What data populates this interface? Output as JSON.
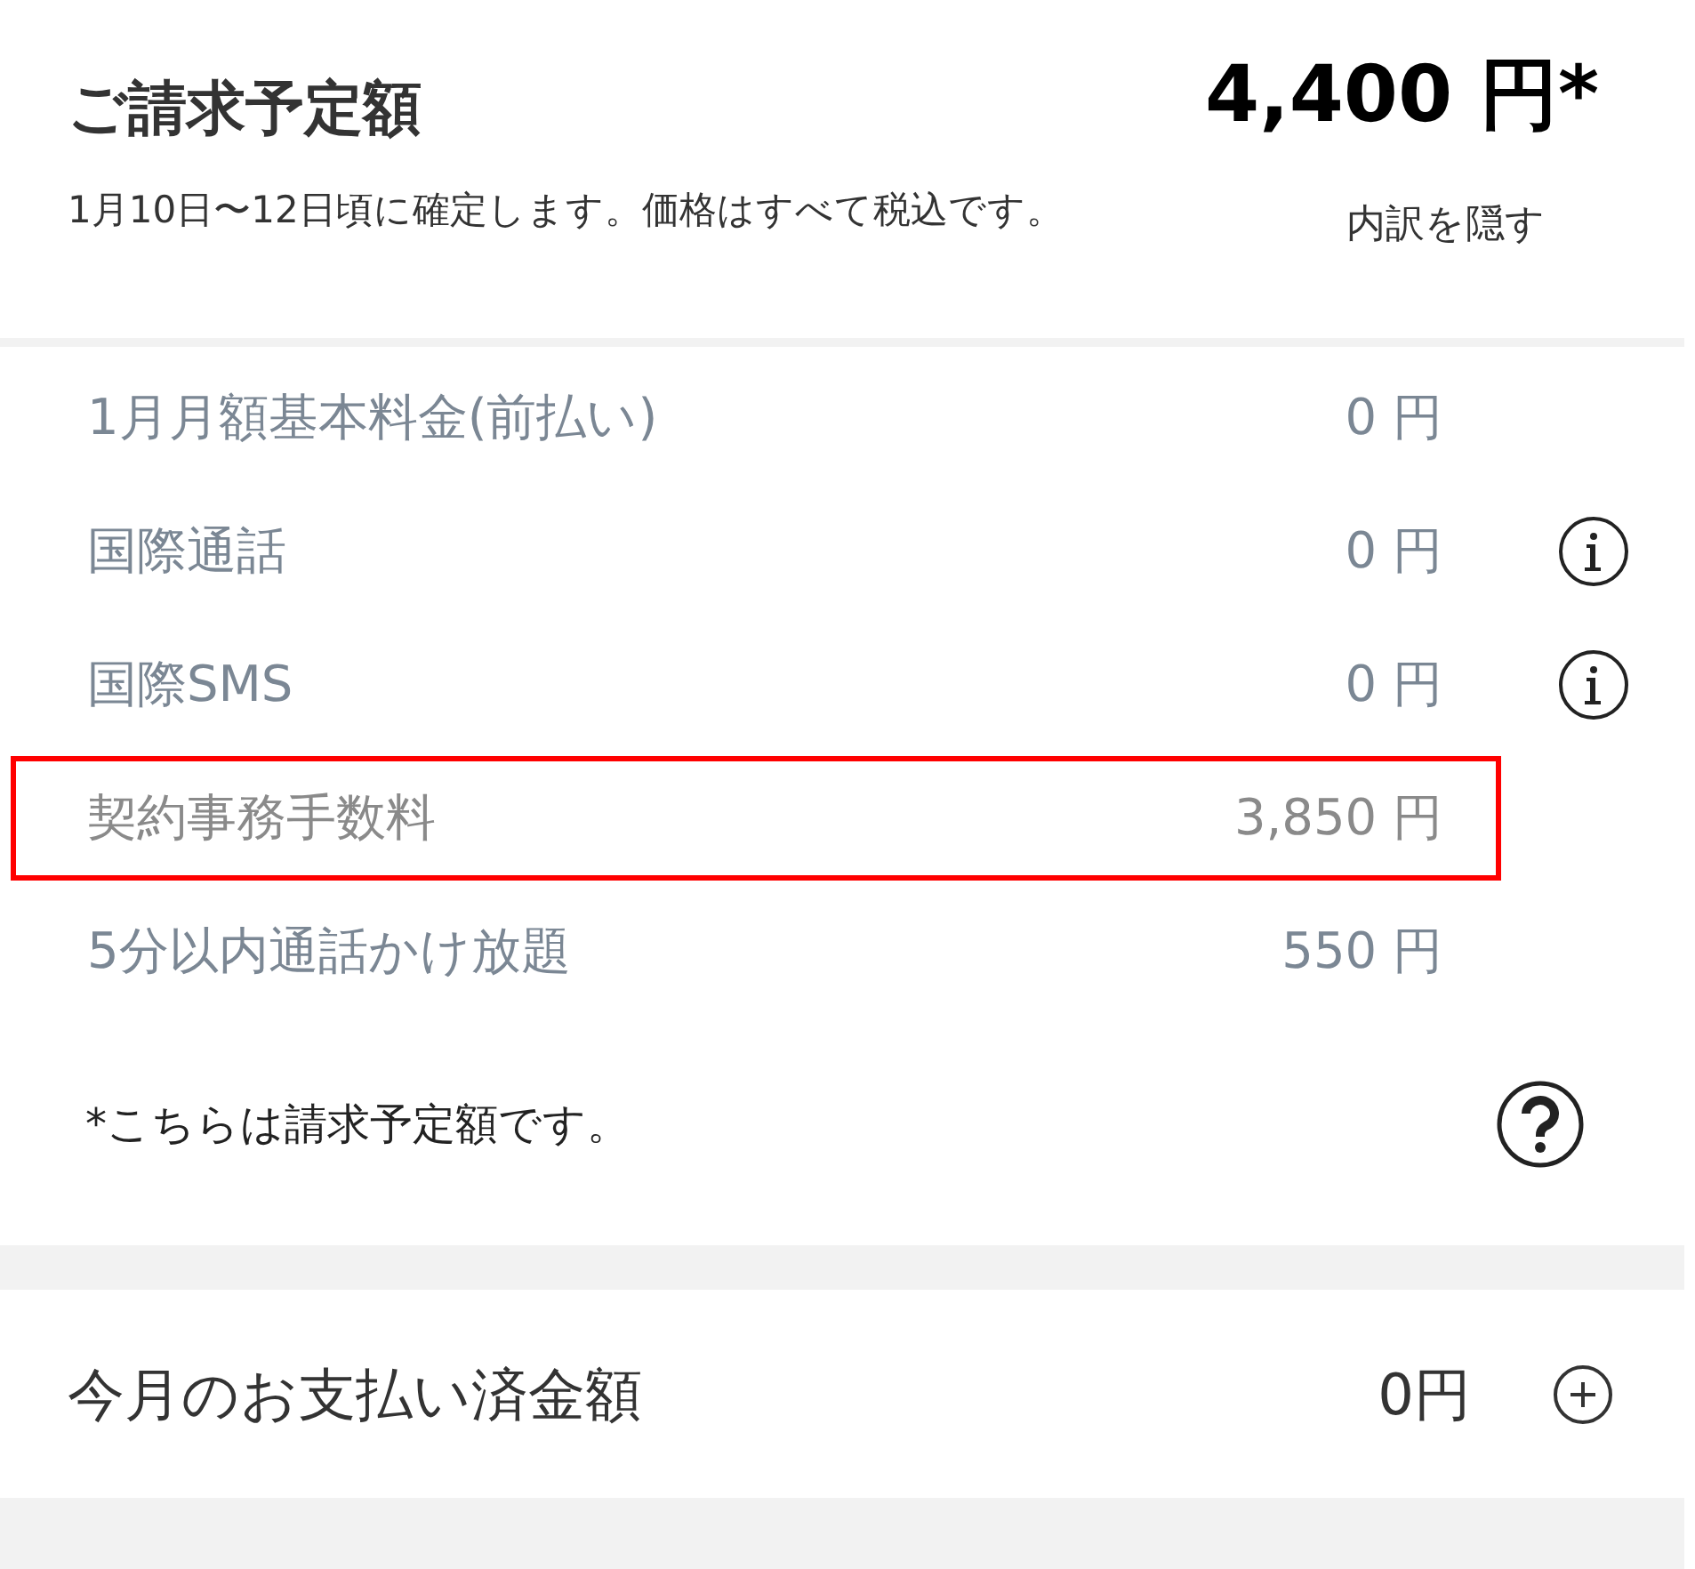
{
  "summary": {
    "title": "ご請求予定額",
    "amount": "4,400 円*",
    "note": "1月10日〜12日頃に確定します。価格はすべて税込です。",
    "toggle": "内訳を隠す"
  },
  "items": [
    {
      "label": "1月月額基本料金(前払い)",
      "amount": "0 円",
      "info": false,
      "highlighted": false
    },
    {
      "label": "国際通話",
      "amount": "0 円",
      "info": true,
      "highlighted": false
    },
    {
      "label": "国際SMS",
      "amount": "0 円",
      "info": true,
      "highlighted": false
    },
    {
      "label": "契約事務手数料",
      "amount": "3,850 円",
      "info": false,
      "highlighted": true
    },
    {
      "label": "5分以内通話かけ放題",
      "amount": "550 円",
      "info": false,
      "highlighted": false
    }
  ],
  "footnote": "*こちらは請求予定額です。",
  "paid": {
    "label": "今月のお支払い済金額",
    "amount": "0円"
  }
}
